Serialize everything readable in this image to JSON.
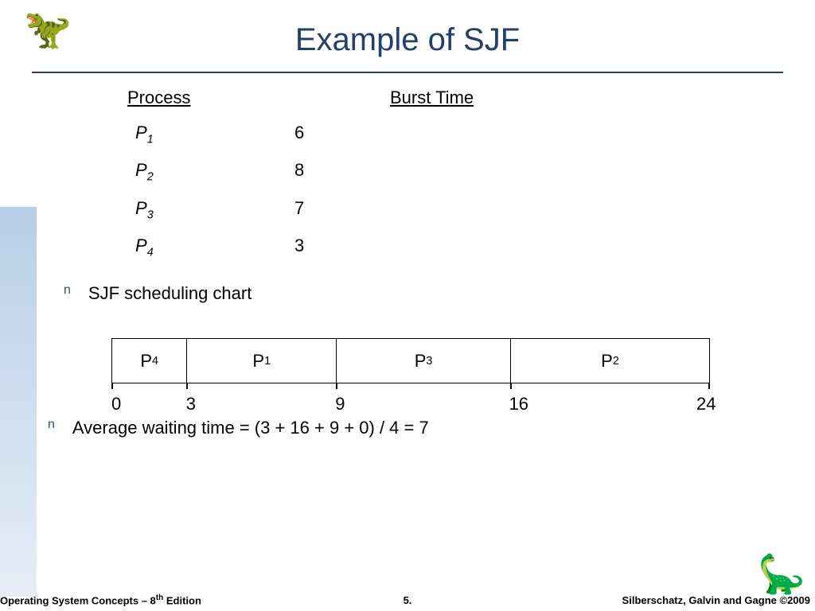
{
  "title": "Example of SJF",
  "headers": {
    "process": "Process",
    "burst": "Burst Time"
  },
  "processes": [
    {
      "name": "P",
      "sub": "1",
      "burst": "6"
    },
    {
      "name": "P",
      "sub": "2",
      "burst": "8"
    },
    {
      "name": "P",
      "sub": "3",
      "burst": "7"
    },
    {
      "name": "P",
      "sub": "4",
      "burst": "3"
    }
  ],
  "bullets": {
    "marker": "n",
    "chart_label": "SJF scheduling chart",
    "avg_prefix": "Average waiting time = (3 + 16 + 9 + 0) / 4 = 7"
  },
  "gantt": {
    "boxes": [
      {
        "label": "P",
        "sub": "4",
        "width": 3
      },
      {
        "label": "P",
        "sub": "1",
        "width": 6
      },
      {
        "label": "P",
        "sub": "3",
        "width": 7
      },
      {
        "label": "P",
        "sub": "2",
        "width": 8
      }
    ],
    "ticks": [
      "0",
      "3",
      "9",
      "16",
      "24"
    ]
  },
  "footer": {
    "left_a": "Operating System Concepts – 8",
    "left_th": "th",
    "left_b": " Edition",
    "mid": "5.",
    "right": "Silberschatz, Galvin and Gagne ©2009"
  },
  "chart_data": {
    "type": "table",
    "columns": [
      "Process",
      "Burst Time"
    ],
    "rows": [
      [
        "P1",
        6
      ],
      [
        "P2",
        8
      ],
      [
        "P3",
        7
      ],
      [
        "P4",
        3
      ]
    ],
    "gantt_order": [
      "P4",
      "P1",
      "P3",
      "P2"
    ],
    "gantt_ticks": [
      0,
      3,
      9,
      16,
      24
    ],
    "average_waiting_time": 7,
    "waiting_time_expression": "(3 + 16 + 9 + 0) / 4 = 7"
  }
}
